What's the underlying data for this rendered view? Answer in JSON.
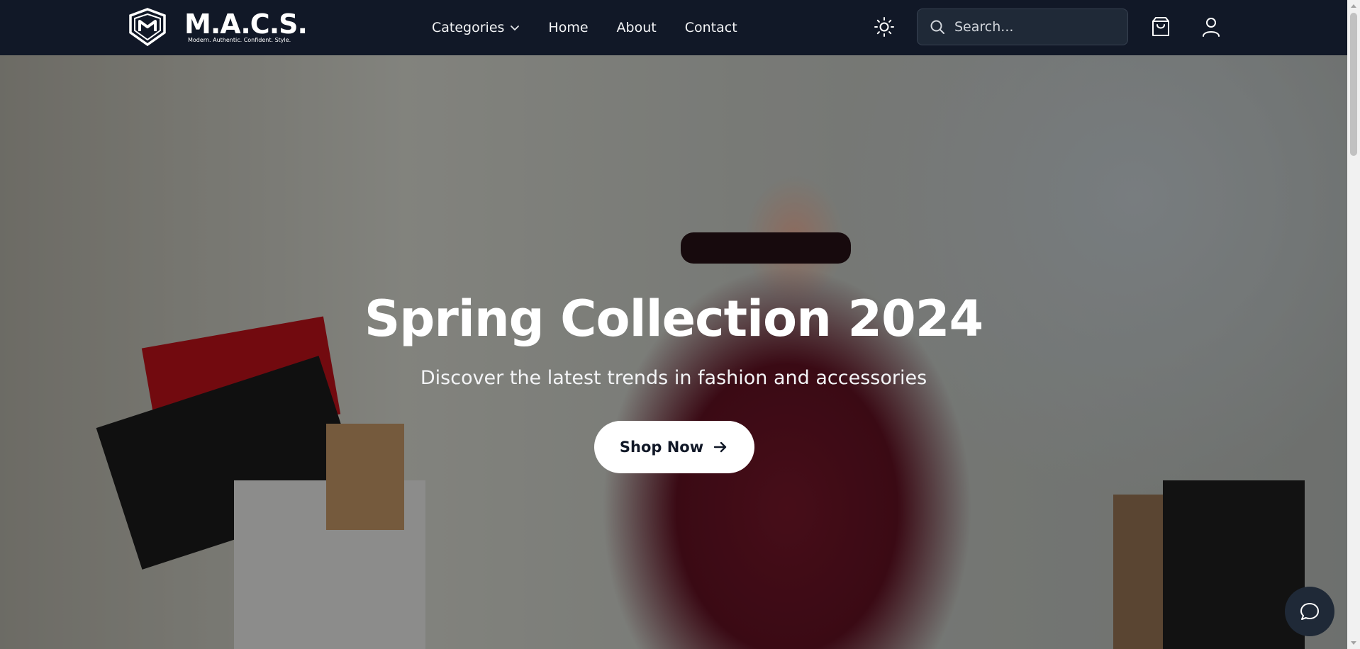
{
  "brand": {
    "name": "M.A.C.S.",
    "tagline": "Modern. Authentic. Confident. Style."
  },
  "nav": {
    "categories_label": "Categories",
    "links": [
      "Home",
      "About",
      "Contact"
    ]
  },
  "search": {
    "placeholder": "Search..."
  },
  "hero": {
    "title": "Spring Collection 2024",
    "subtitle": "Discover the latest trends in fashion and accessories",
    "cta_label": "Shop Now"
  },
  "icons": {
    "logo": "shield-logo-icon",
    "categories": "chevron-down-icon",
    "theme": "sun-icon",
    "search": "search-icon",
    "cart": "shopping-bag-icon",
    "account": "user-icon",
    "cta": "arrow-right-icon",
    "chat": "chat-bubble-icon"
  },
  "colors": {
    "navbar_bg": "#111827",
    "search_bg": "#1f2937",
    "cta_bg": "#ffffff",
    "chat_bg": "#1f2937"
  }
}
